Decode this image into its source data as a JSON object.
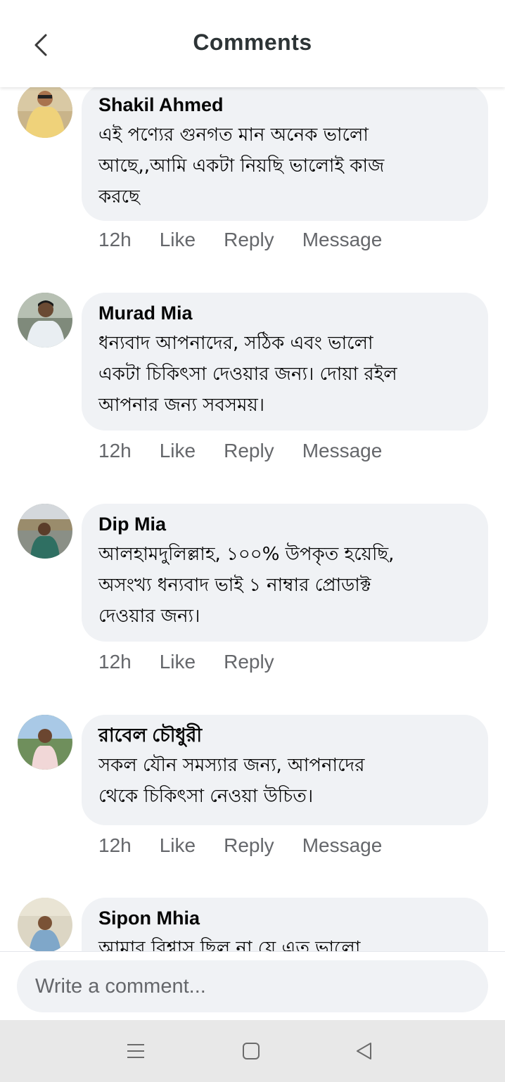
{
  "header": {
    "title": "Comments",
    "back_icon": "chevron-left-icon"
  },
  "comments": [
    {
      "name": "Shakil Ahmed",
      "text": "এই পণ্যের গুনগত মান অনেক ভালো\nআছে,,আমি একটা নিয়ছি ভালোই কাজ\nকরছে",
      "time": "12h",
      "like": "Like",
      "reply": "Reply",
      "message": "Message"
    },
    {
      "name": "Murad Mia",
      "text": "ধন্যবাদ আপনাদের, সঠিক এবং ভালো\nএকটা চিকিৎসা দেওয়ার জন্য। দোয়া রইল\nআপনার জন্য সবসময়।",
      "time": "12h",
      "like": "Like",
      "reply": "Reply",
      "message": "Message"
    },
    {
      "name": "Dip Mia",
      "text": "আলহামদুলিল্লাহ, ১০০% উপকৃত হয়েছি,\nঅসংখ্য ধন্যবাদ ভাই ১ নাম্বার প্রোডাক্ট\nদেওয়ার জন্য।",
      "time": "12h",
      "like": "Like",
      "reply": "Reply"
    },
    {
      "name": "রাবেল চৌধুরী",
      "text": "সকল যৌন সমস্যার জন্য, আপনাদের\nথেকে চিকিৎসা নেওয়া উচিত।",
      "time": "12h",
      "like": "Like",
      "reply": "Reply",
      "message": "Message"
    },
    {
      "name": "Sipon Mhia",
      "text": "আমার বিশ্বাস ছিল না যে এত ভালো"
    }
  ],
  "composer": {
    "placeholder": "Write a comment..."
  },
  "navbar": {
    "menu_icon": "menu-icon",
    "home_icon": "home-square-icon",
    "back_icon": "back-triangle-icon"
  },
  "colors": {
    "bubble": "#f0f2f5",
    "meta_text": "#65676b",
    "title": "#2d3436"
  }
}
